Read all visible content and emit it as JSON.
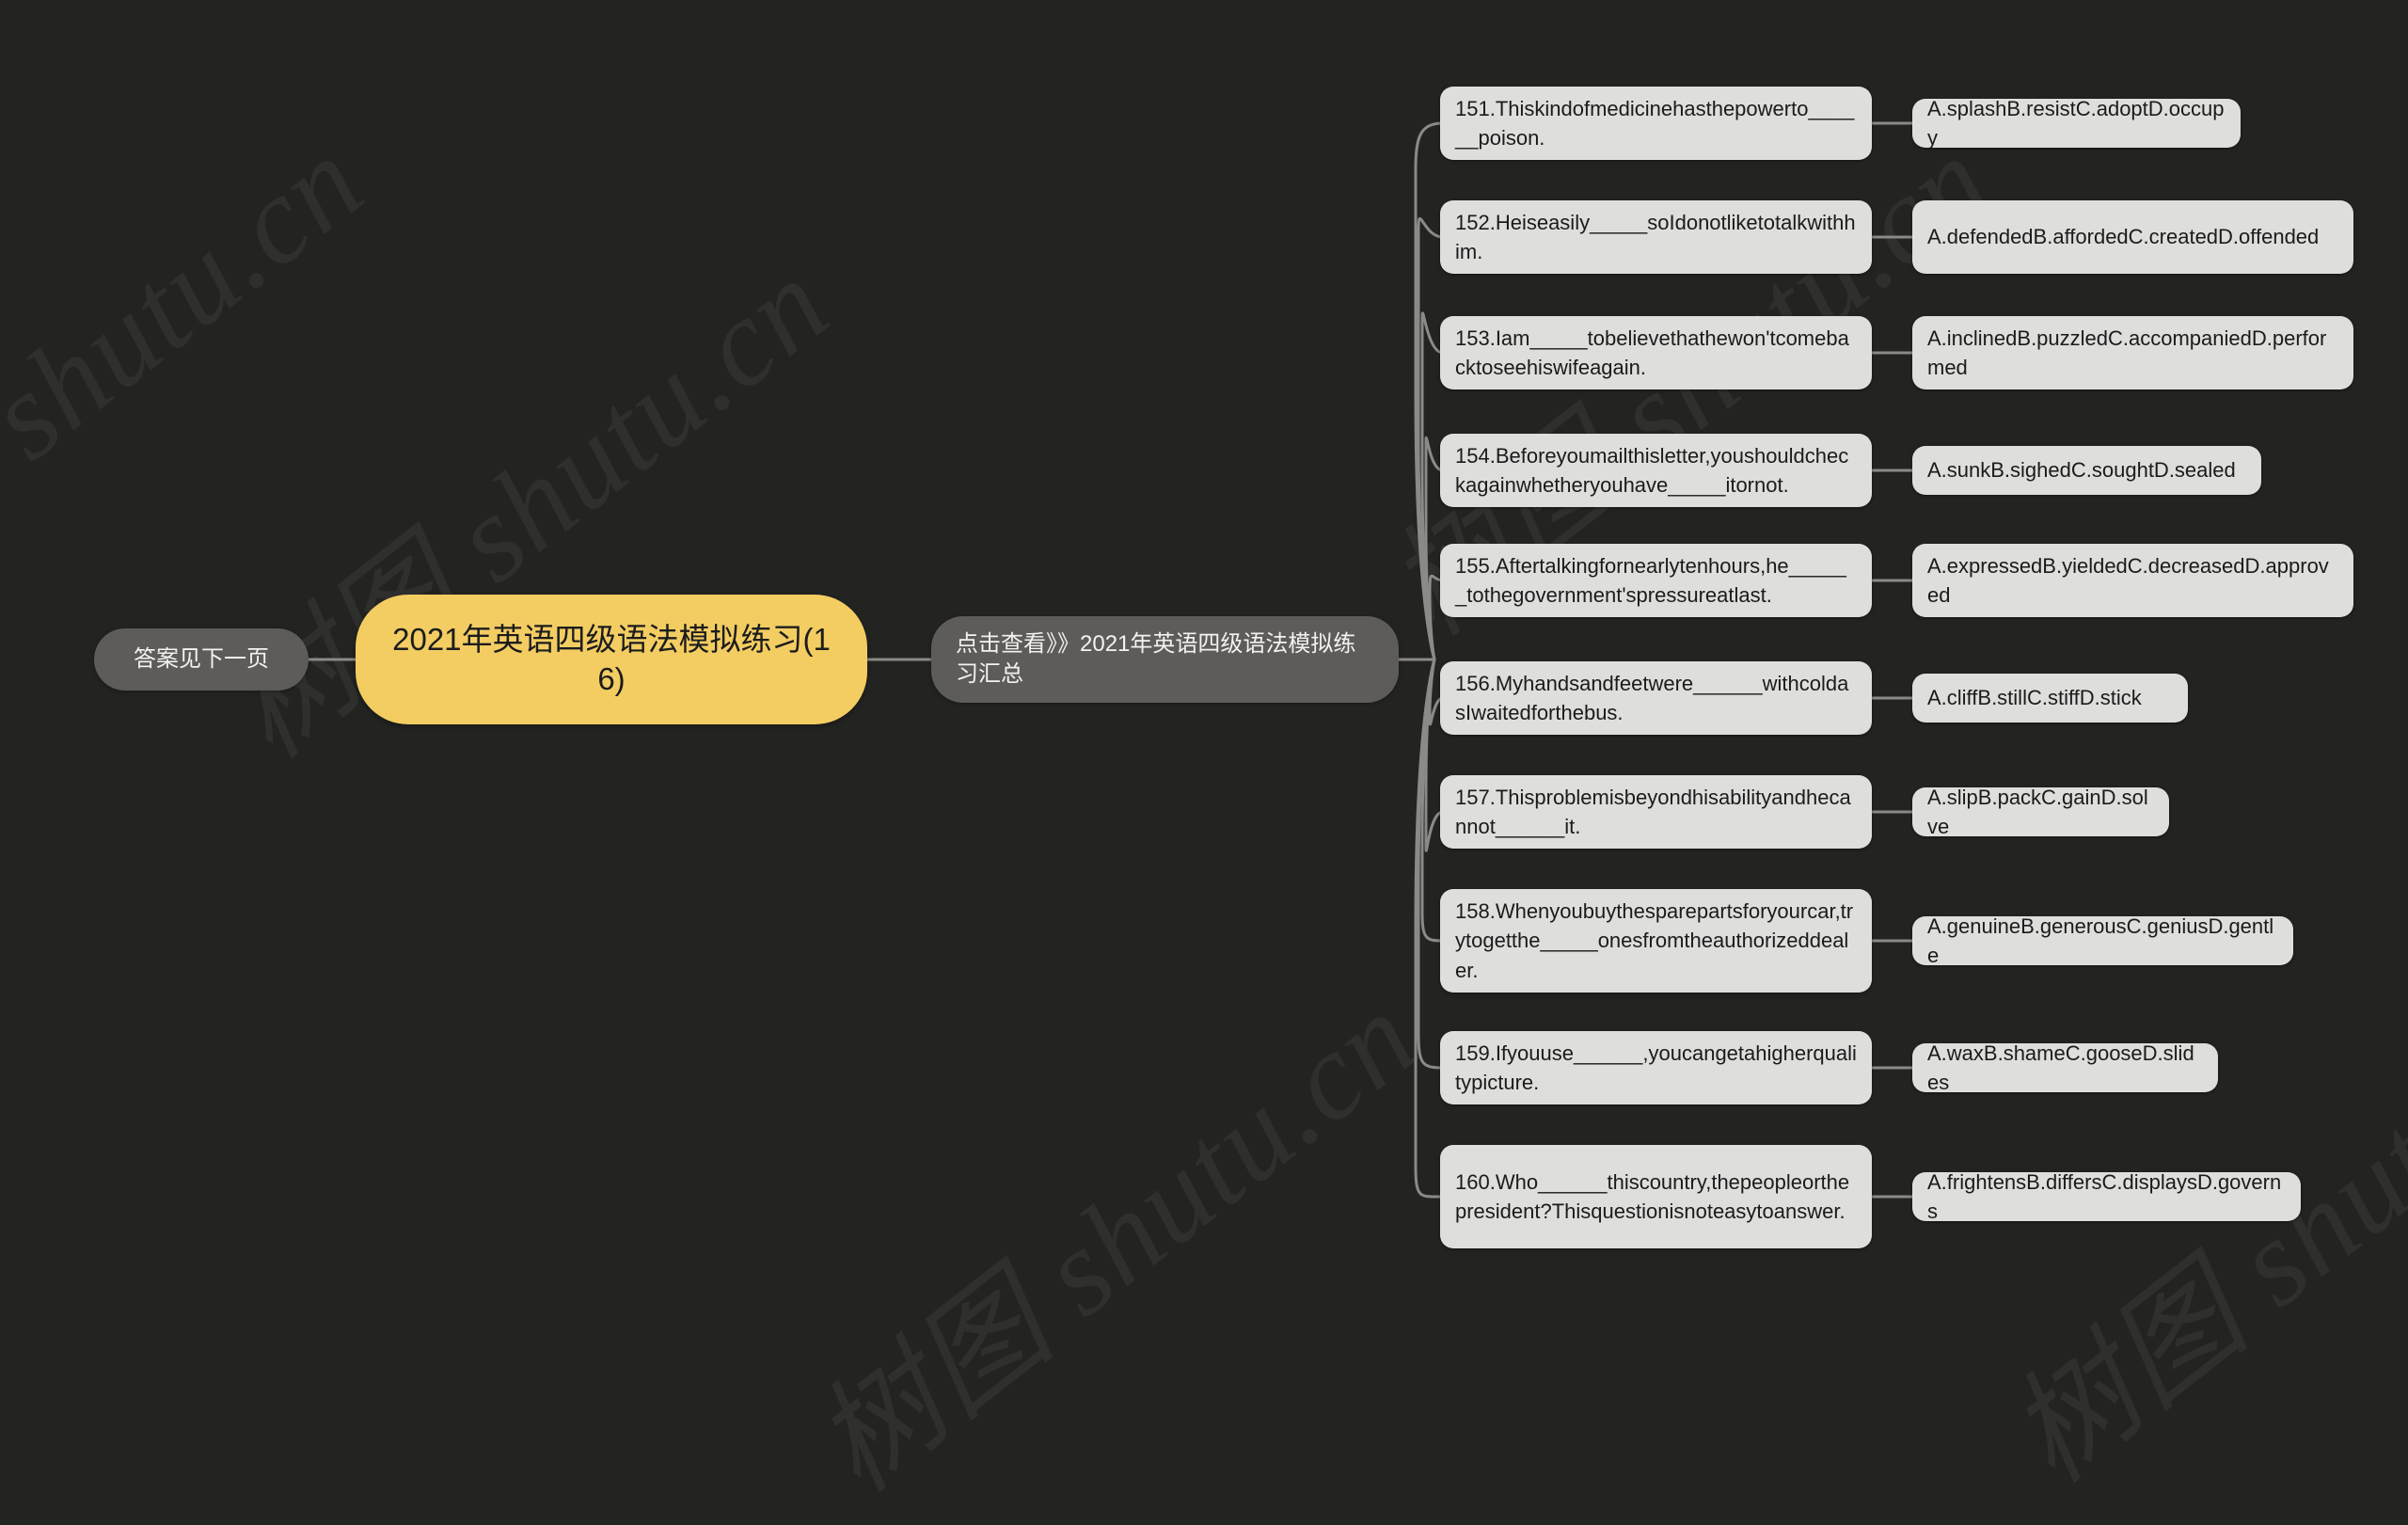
{
  "theme": {
    "background": "#232322",
    "root_fill": "#f3cd62",
    "branch_fill": "#5e5c58",
    "leaf_fill": "#dededc",
    "link_stroke": "#8b8a86",
    "root_text": "#1c1c1c",
    "branch_text": "#f2f2f0",
    "leaf_text": "#1b1b1b"
  },
  "watermark": {
    "text": "树图 shutu.cn",
    "short_text": "cn"
  },
  "mindmap": {
    "root": {
      "label": "2021年英语四级语法模拟练习(16)"
    },
    "left_note": {
      "label": "答案见下一页"
    },
    "summary": {
      "label": "点击查看》》2021年英语四级语法模拟练习汇总"
    },
    "items": [
      {
        "question": "151.Thiskindofmedicinehasthepowerto______poison.",
        "answer": "A.splashB.resistC.adoptD.occupy"
      },
      {
        "question": "152.Heiseasily_____soIdonotliketotalkwithhim.",
        "answer": "A.defendedB.affordedC.createdD.offended"
      },
      {
        "question": "153.Iam_____tobelievethathewon'tcomebacktoseehiswifeagain.",
        "answer": "A.inclinedB.puzzledC.accompaniedD.performed"
      },
      {
        "question": "154.Beforeyoumailthisletter,youshouldcheckagainwhetheryouhave_____itornot.",
        "answer": "A.sunkB.sighedC.soughtD.sealed"
      },
      {
        "question": "155.Aftertalkingfornearlytenhours,he______tothegovernment'spressureatlast.",
        "answer": "A.expressedB.yieldedC.decreasedD.approved"
      },
      {
        "question": "156.Myhandsandfeetwere______withcoldasIwaitedforthebus.",
        "answer": "A.cliffB.stillC.stiffD.stick"
      },
      {
        "question": "157.Thisproblemisbeyondhisabilityandhecannot______it.",
        "answer": "A.slipB.packC.gainD.solve"
      },
      {
        "question": "158.Whenyoubuythesparepartsforyourcar,trytogetthe_____onesfromtheauthorizeddealer.",
        "answer": "A.genuineB.generousC.geniusD.gentle"
      },
      {
        "question": "159.Ifyouuse______,youcangetahigherqualitypicture.",
        "answer": "A.waxB.shameC.gooseD.slides"
      },
      {
        "question": "160.Who______thiscountry,thepeopleorthepresident?Thisquestionisnoteasytoanswer.",
        "answer": "A.frightensB.differsC.displaysD.governs"
      }
    ]
  }
}
